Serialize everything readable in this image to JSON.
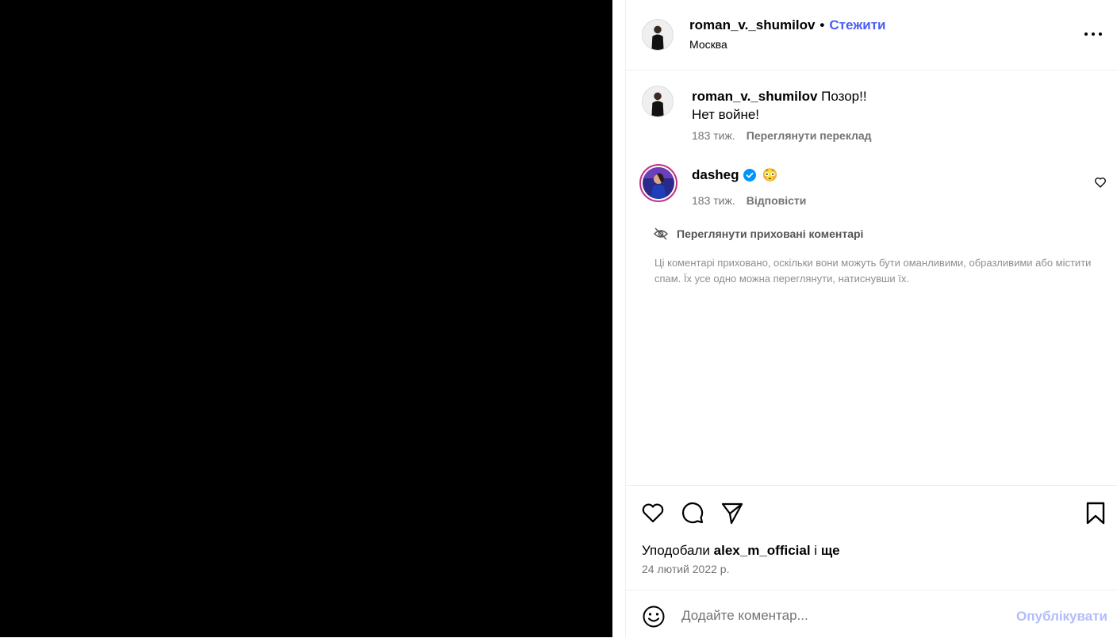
{
  "post": {
    "author": "roman_v._shumilov",
    "follow_label": "Стежити",
    "separator": "•",
    "location": "Москва"
  },
  "caption": {
    "author": "roman_v._shumilov",
    "line1": "Позор!!",
    "line2": "Нет войне!",
    "time": "183 тиж.",
    "translate_label": "Переглянути переклад"
  },
  "comment": {
    "author": "dasheg",
    "verified_icon": "verified-badge-icon",
    "emoji": "😳",
    "time": "183 тиж.",
    "reply_label": "Відповісти"
  },
  "hidden_comments": {
    "label": "Переглянути приховані коментарі",
    "note": "Ці коментарі приховано, оскільки вони можуть бути оманливими, образливими або містити спам. Їх усе одно можна переглянути, натиснувши їх."
  },
  "likes": {
    "prefix": "Уподобали",
    "user": "alex_m_official",
    "joiner": "і",
    "more": "ще"
  },
  "date": "24 лютий 2022 р.",
  "add_comment": {
    "placeholder": "Додайте коментар...",
    "post_label": "Опублікувати"
  },
  "colors": {
    "follow": "#4a5df9",
    "post_disabled": "#b2bdfb",
    "verified": "#0095f6",
    "muted": "#737373"
  }
}
